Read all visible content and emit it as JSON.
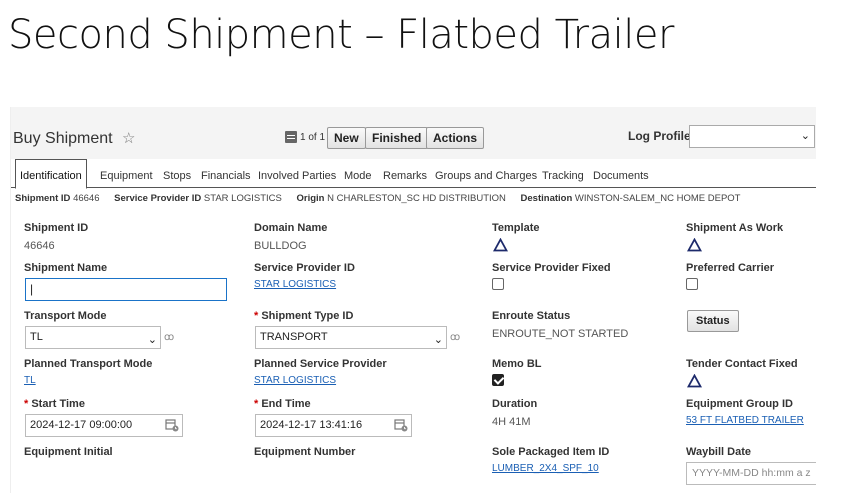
{
  "slide": {
    "title": "Second Shipment – Flatbed Trailer"
  },
  "header": {
    "title": "Buy Shipment",
    "pager": "1 of 1",
    "buttons": {
      "new": "New",
      "finished": "Finished",
      "actions": "Actions"
    },
    "log_profile_label": "Log Profile",
    "log_profile_value": ""
  },
  "tabs": [
    "Identification",
    "Equipment",
    "Stops",
    "Financials",
    "Involved Parties",
    "Mode",
    "Remarks",
    "Groups and Charges",
    "Tracking",
    "Documents"
  ],
  "summary": {
    "shipment_id_label": "Shipment ID",
    "shipment_id": "46646",
    "service_provider_label": "Service Provider ID",
    "service_provider": "STAR LOGISTICS",
    "origin_label": "Origin",
    "origin": "N CHARLESTON_SC HD DISTRIBUTION",
    "destination_label": "Destination",
    "destination": "WINSTON-SALEM_NC HOME DEPOT"
  },
  "fields": {
    "shipment_id": {
      "label": "Shipment ID",
      "value": "46646"
    },
    "domain_name": {
      "label": "Domain Name",
      "value": "BULLDOG"
    },
    "template": {
      "label": "Template",
      "icon": "triangle-icon"
    },
    "shipment_as_work": {
      "label": "Shipment As Work",
      "icon": "triangle-icon"
    },
    "shipment_name": {
      "label": "Shipment Name",
      "value": "|"
    },
    "service_provider_id": {
      "label": "Service Provider ID",
      "value": "STAR LOGISTICS"
    },
    "service_provider_fixed": {
      "label": "Service Provider Fixed",
      "checked": false
    },
    "preferred_carrier": {
      "label": "Preferred Carrier",
      "checked": false
    },
    "transport_mode": {
      "label": "Transport Mode",
      "value": "TL"
    },
    "shipment_type_id": {
      "required": "*",
      "label": "Shipment Type ID",
      "value": "TRANSPORT"
    },
    "enroute_status": {
      "label": "Enroute Status",
      "value": "ENROUTE_NOT STARTED"
    },
    "status_button": "Status",
    "planned_transport_mode": {
      "label": "Planned Transport Mode",
      "value": "TL"
    },
    "planned_service_provider": {
      "label": "Planned Service Provider",
      "value": "STAR LOGISTICS"
    },
    "memo_bl": {
      "label": "Memo BL",
      "checked": true
    },
    "tender_contact_fixed": {
      "label": "Tender Contact Fixed",
      "icon": "triangle-icon"
    },
    "start_time": {
      "required": "*",
      "label": "Start Time",
      "value": "2024-12-17 09:00:00"
    },
    "end_time": {
      "required": "*",
      "label": "End Time",
      "value": "2024-12-17 13:41:16"
    },
    "duration": {
      "label": "Duration",
      "value": "4H 41M"
    },
    "equipment_group_id": {
      "label": "Equipment Group ID",
      "value": "53 FT FLATBED TRAILER"
    },
    "equipment_initial": {
      "label": "Equipment Initial"
    },
    "equipment_number": {
      "label": "Equipment Number"
    },
    "sole_packaged_item_id": {
      "label": "Sole Packaged Item ID",
      "value": "LUMBER_2X4_SPF_10"
    },
    "waybill_date": {
      "label": "Waybill Date",
      "placeholder": "YYYY-MM-DD hh:mm a z"
    }
  },
  "colors": {
    "link": "#1a5fb4",
    "required": "#c00000",
    "focus": "#1a73c8"
  }
}
